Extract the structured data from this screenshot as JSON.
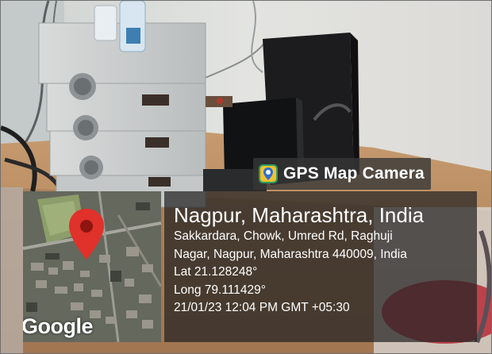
{
  "app": {
    "badge_label": "GPS Map Camera",
    "badge_icon": "camera-pin-icon"
  },
  "location": {
    "place": "Nagpur, Maharashtra, India",
    "address_line1": "Sakkardara, Chowk, Umred Rd, Raghuji",
    "address_line2": "Nagar, Nagpur, Maharashtra 440009, India",
    "latitude": "Lat 21.128248°",
    "longitude": "Long 79.111429°",
    "timestamp": "21/01/23 12:04 PM GMT +05:30"
  },
  "map": {
    "attribution": "Google",
    "pin_icon": "map-pin-icon",
    "pin_color": "#e0312a"
  },
  "colors": {
    "overlay": "#232323",
    "text": "#ffffff"
  }
}
